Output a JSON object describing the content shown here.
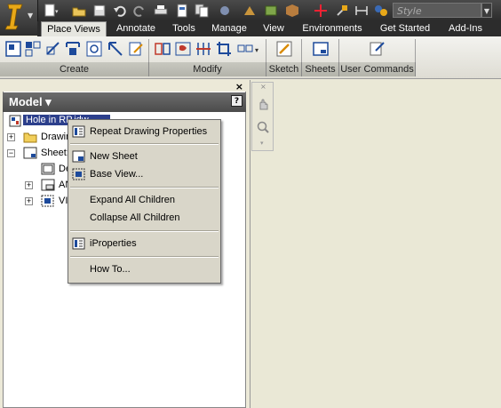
{
  "quick_access": {
    "style_placeholder": "Style",
    "dropdown_arrow": "▼"
  },
  "tabs": [
    {
      "label": "Place Views"
    },
    {
      "label": "Annotate"
    },
    {
      "label": "Tools"
    },
    {
      "label": "Manage"
    },
    {
      "label": "View"
    },
    {
      "label": "Environments"
    },
    {
      "label": "Get Started"
    },
    {
      "label": "Add-Ins"
    }
  ],
  "ribbon": {
    "panels": {
      "create": "Create",
      "modify": "Modify",
      "sketch": "Sketch",
      "sheets": "Sheets",
      "user_commands": "User Commands"
    }
  },
  "browser": {
    "title": "Model ▾",
    "help": "?",
    "close": "×",
    "tree": {
      "root": "Hole in RP.idw",
      "drawing": "Drawing Resources",
      "sheet": "Sheet:1",
      "default_border": "Default Border",
      "ansi": "ANSI",
      "view": "VIEW1"
    }
  },
  "context_menu": {
    "items": [
      {
        "label": "Repeat Drawing Properties",
        "icon": "properties-icon"
      },
      {
        "label": "New Sheet",
        "icon": "new-sheet-icon"
      },
      {
        "label": "Base View...",
        "icon": "base-view-icon"
      },
      {
        "label": "Expand All Children",
        "icon": ""
      },
      {
        "label": "Collapse All Children",
        "icon": ""
      },
      {
        "label": "iProperties",
        "icon": "iproperties-icon"
      },
      {
        "label": "How To...",
        "icon": ""
      }
    ]
  },
  "colors": {
    "accent": "#2c3f8c",
    "canvas": "#eae8d6",
    "ribbon_tabs": "#2c2c2c"
  }
}
